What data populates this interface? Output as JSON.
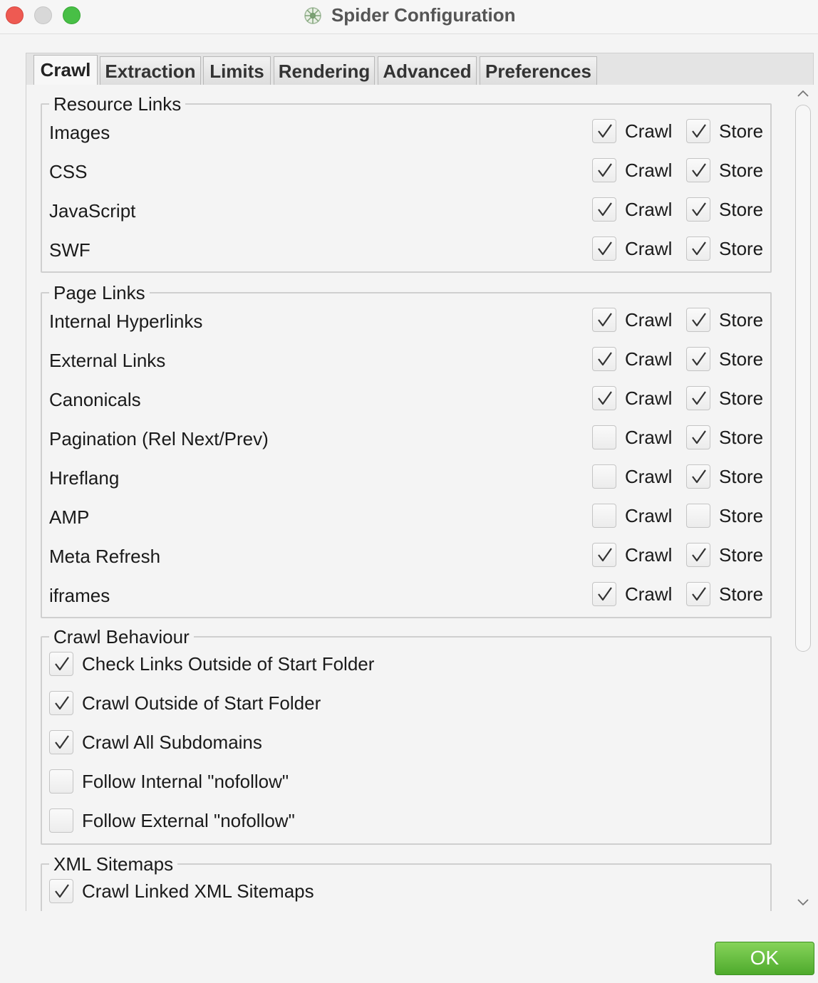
{
  "window": {
    "title": "Spider Configuration",
    "app_icon": "spider-icon"
  },
  "tabs": [
    {
      "label": "Crawl",
      "active": true
    },
    {
      "label": "Extraction",
      "active": false
    },
    {
      "label": "Limits",
      "active": false
    },
    {
      "label": "Rendering",
      "active": false
    },
    {
      "label": "Advanced",
      "active": false
    },
    {
      "label": "Preferences",
      "active": false
    }
  ],
  "option_labels": {
    "crawl": "Crawl",
    "store": "Store"
  },
  "resource_links": {
    "title": "Resource Links",
    "items": [
      {
        "label": "Images",
        "crawl": true,
        "store": true
      },
      {
        "label": "CSS",
        "crawl": true,
        "store": true
      },
      {
        "label": "JavaScript",
        "crawl": true,
        "store": true
      },
      {
        "label": "SWF",
        "crawl": true,
        "store": true
      }
    ]
  },
  "page_links": {
    "title": "Page Links",
    "items": [
      {
        "label": "Internal Hyperlinks",
        "crawl": true,
        "store": true
      },
      {
        "label": "External Links",
        "crawl": true,
        "store": true
      },
      {
        "label": "Canonicals",
        "crawl": true,
        "store": true
      },
      {
        "label": "Pagination (Rel Next/Prev)",
        "crawl": false,
        "store": true
      },
      {
        "label": "Hreflang",
        "crawl": false,
        "store": true
      },
      {
        "label": "AMP",
        "crawl": false,
        "store": false
      },
      {
        "label": "Meta Refresh",
        "crawl": true,
        "store": true
      },
      {
        "label": "iframes",
        "crawl": true,
        "store": true
      }
    ]
  },
  "crawl_behaviour": {
    "title": "Crawl Behaviour",
    "items": [
      {
        "label": "Check Links Outside of Start Folder",
        "checked": true
      },
      {
        "label": "Crawl Outside of Start Folder",
        "checked": true
      },
      {
        "label": "Crawl All Subdomains",
        "checked": true
      },
      {
        "label": "Follow Internal \"nofollow\"",
        "checked": false
      },
      {
        "label": "Follow External \"nofollow\"",
        "checked": false
      }
    ]
  },
  "xml_sitemaps": {
    "title": "XML Sitemaps",
    "items": [
      {
        "label": "Crawl Linked XML Sitemaps",
        "checked": true
      }
    ]
  },
  "buttons": {
    "ok": "OK"
  },
  "colors": {
    "ok_button": "#5cb833",
    "close": "#ee5a52",
    "maximize": "#48bf46"
  }
}
